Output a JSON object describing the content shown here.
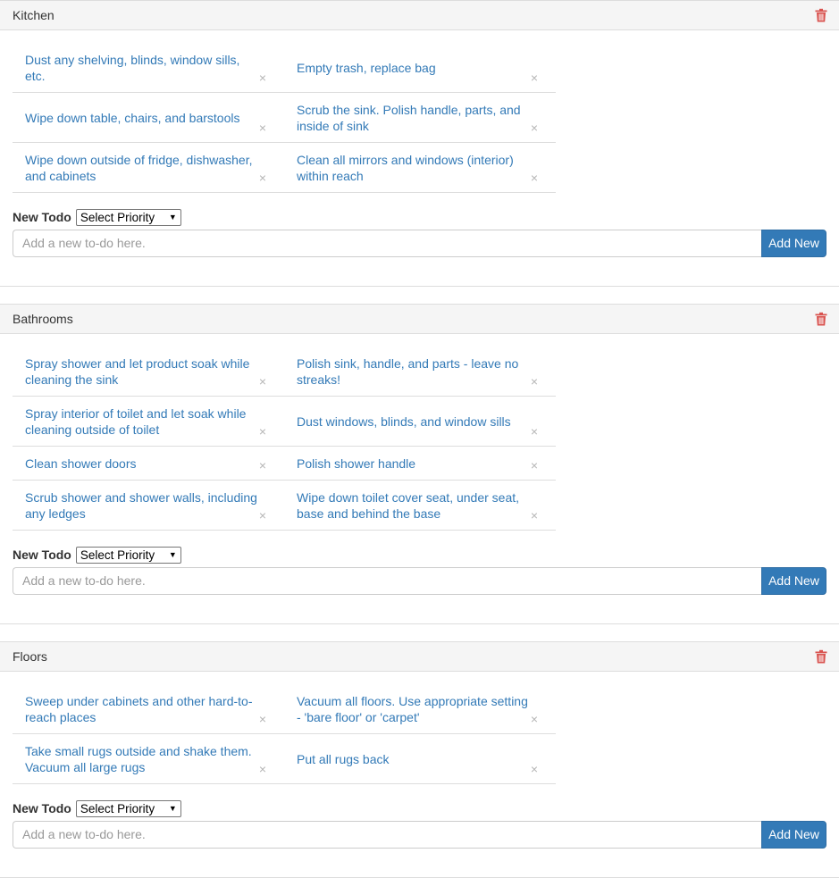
{
  "sections": [
    {
      "title": "Kitchen",
      "todos": [
        "Dust any shelving, blinds, window sills, etc.",
        "Empty trash, replace bag",
        "Wipe down table, chairs, and barstools",
        "Scrub the sink. Polish handle, parts, and inside of sink",
        "Wipe down outside of fridge, dishwasher, and cabinets",
        "Clean all mirrors and windows (interior) within reach"
      ]
    },
    {
      "title": "Bathrooms",
      "todos": [
        "Spray shower and let product soak while cleaning the sink",
        "Polish sink, handle, and parts - leave no streaks!",
        "Spray interior of toilet and let soak while cleaning outside of toilet",
        "Dust windows, blinds, and window sills",
        "Clean shower doors",
        "Polish shower handle",
        "Scrub shower and shower walls, including any ledges",
        "Wipe down toilet cover seat, under seat, base and behind the base"
      ]
    },
    {
      "title": "Floors",
      "todos": [
        "Sweep under cabinets and other hard-to-reach places",
        "Vacuum all floors. Use appropriate setting - 'bare floor' or 'carpet'",
        "Take small rugs outside and shake them. Vacuum all large rugs",
        "Put all rugs back"
      ]
    }
  ],
  "form": {
    "new_todo_label": "New Todo",
    "priority_select_value": "Select Priority",
    "input_placeholder": "Add a new to-do here.",
    "add_button_label": "Add New"
  },
  "icons": {
    "remove": "×",
    "trash": "trash-icon",
    "select_caret": "▼"
  },
  "colors": {
    "link": "#337ab7",
    "button": "#337ab7",
    "trash": "#d9534f",
    "remove_x": "#b5b5b5",
    "heading_bg": "#f5f5f5"
  }
}
